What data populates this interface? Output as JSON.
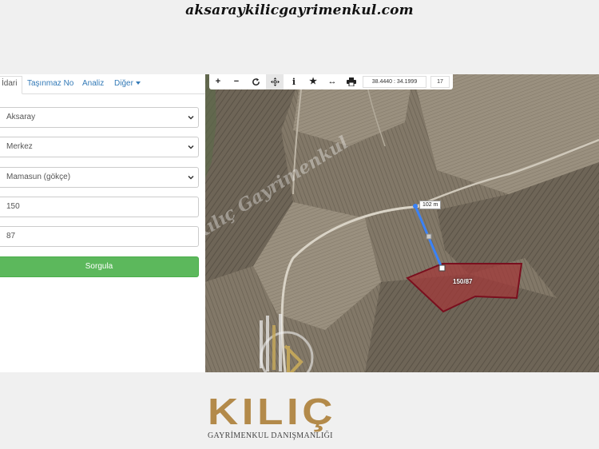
{
  "header": {
    "site_url": "aksaraykilicgayrimenkul.com"
  },
  "panel": {
    "tabs": [
      {
        "label": "İdari",
        "active": true
      },
      {
        "label": "Taşınmaz No"
      },
      {
        "label": "Analiz"
      },
      {
        "label": "Diğer"
      }
    ],
    "fields": {
      "province": "Aksaray",
      "district": "Merkez",
      "neighborhood": "Mamasun (gökçe)",
      "block": "150",
      "parcel": "87"
    },
    "query_button": "Sorgula"
  },
  "toolbar": {
    "coordinates": "38.4440 : 34.1999",
    "zoom_level": "17",
    "tools": [
      "zoom-in-icon",
      "zoom-out-icon",
      "refresh-icon",
      "pan-icon",
      "info-icon",
      "star-icon",
      "measure-icon",
      "print-icon"
    ]
  },
  "map": {
    "measure_label": "102 m",
    "parcel_label": "150/87",
    "watermark": "Kılıç Gayrimenkul",
    "parcel_color": "#a23a3a",
    "measure_color": "#3b82f6"
  },
  "logo": {
    "name": "KILIÇ",
    "tagline": "GAYRİMENKUL DANIŞMANLIĞI"
  }
}
